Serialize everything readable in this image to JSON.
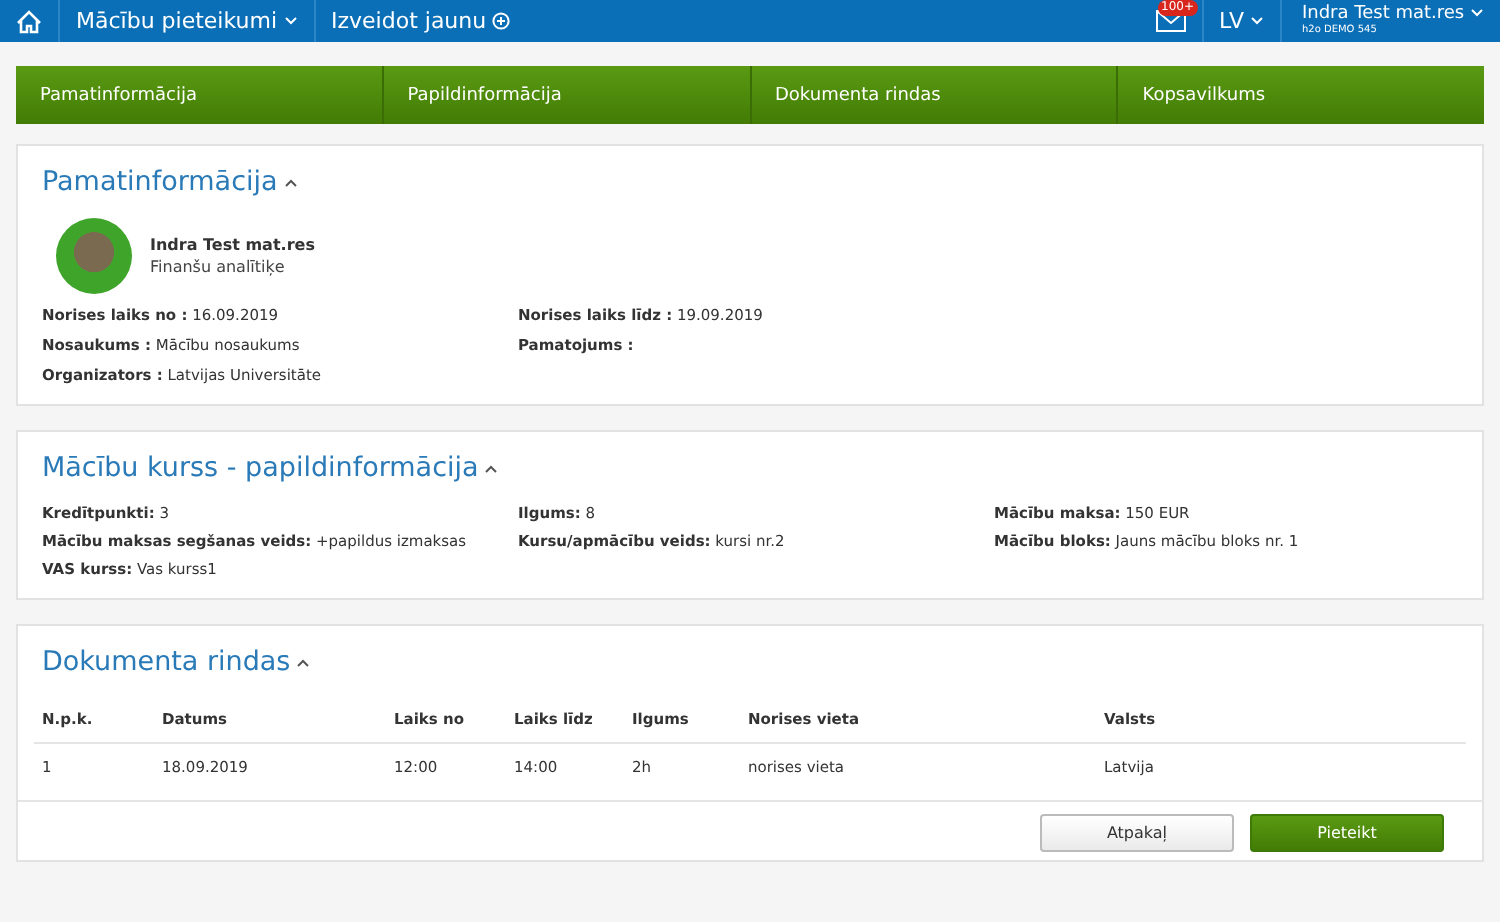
{
  "topbar": {
    "module": "Mācību pieteikumi",
    "create": "Izveidot jaunu",
    "mail_badge": "100+",
    "language": "LV",
    "user_name": "Indra Test mat.res",
    "user_org": "h2o DEMO 545"
  },
  "steps": [
    "Pamatinformācija",
    "Papildinformācija",
    "Dokumenta rindas",
    "Kopsavilkums"
  ],
  "basic_info": {
    "title": "Pamatinformācija",
    "person_name": "Indra Test mat.res",
    "person_role": "Finanšu analītiķe",
    "fields": [
      {
        "label": "Norises laiks no :",
        "value": "16.09.2019"
      },
      {
        "label": "Norises laiks līdz :",
        "value": "19.09.2019"
      },
      {
        "label": "Nosaukums :",
        "value": "Mācību nosaukums"
      },
      {
        "label": "Pamatojums :"
      },
      {
        "label": "Organizators :",
        "value": "Latvijas Universitāte"
      }
    ]
  },
  "course_info": {
    "title": "Mācību kurss - papildinformācija",
    "fields": [
      {
        "label": "Kredītpunkti:",
        "value": "3"
      },
      {
        "label": "Ilgums:",
        "value": "8"
      },
      {
        "label": "Mācību maksa:",
        "value": "150 EUR"
      },
      {
        "label": "Mācību maksas segšanas veids:",
        "value": "+papildus izmaksas"
      },
      {
        "label": "Kursu/apmācību veids:",
        "value": "kursi nr.2"
      },
      {
        "label": "Mācību bloks:",
        "value": "Jauns mācību bloks nr. 1"
      },
      {
        "label": "VAS kurss:",
        "value": "Vas kurss1"
      }
    ]
  },
  "document_rows": {
    "title": "Dokumenta rindas",
    "columns": [
      "N.p.k.",
      "Datums",
      "Laiks no",
      "Laiks līdz",
      "Ilgums",
      "Norises vieta",
      "Valsts"
    ],
    "rows": [
      [
        "1",
        "18.09.2019",
        "12:00",
        "14:00",
        "2h",
        "norises vieta",
        "Latvija"
      ]
    ]
  },
  "buttons": {
    "back": "Atpakaļ",
    "submit": "Pieteikt"
  }
}
